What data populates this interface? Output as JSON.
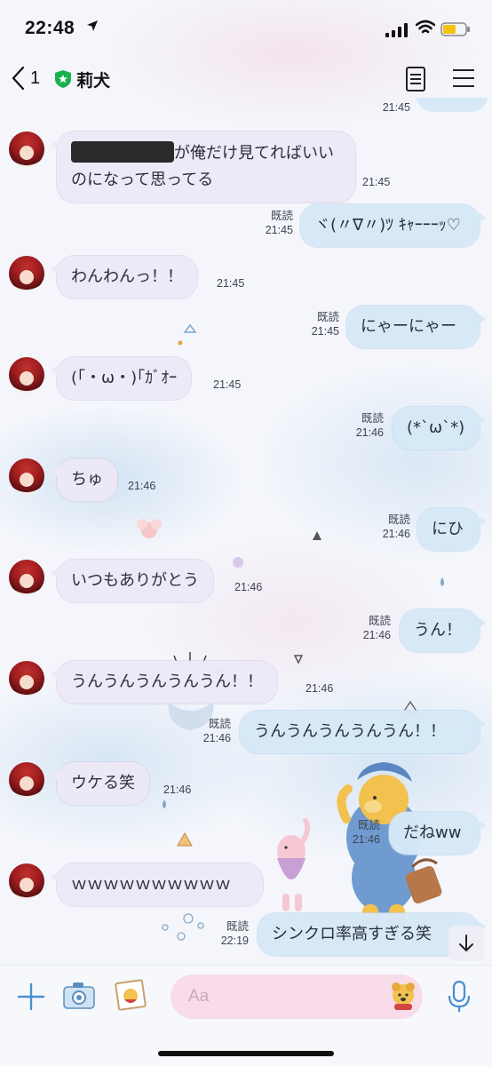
{
  "status_bar": {
    "time": "22:48"
  },
  "header": {
    "back_count": "1",
    "title": "莉犬"
  },
  "colors": {
    "bubble_incoming": "#ece8f6",
    "bubble_outgoing": "#d6e8f7",
    "input_background": "#f8dcea",
    "accent_icon": "#4a8fd1"
  },
  "messages": [
    {
      "side": "in",
      "text": "が俺だけ見てればいい\nのになって思ってる",
      "time": "21:45",
      "redacted_prefix": true
    },
    {
      "side": "out",
      "text": "ヾ(〃∇〃)ﾂ ｷｬｰｰｰｯ♡",
      "read": "既読",
      "time": "21:45"
    },
    {
      "side": "in",
      "text": "わんわんっ！！",
      "time": "21:45"
    },
    {
      "side": "out",
      "text": "にゃーにゃー",
      "read": "既読",
      "time": "21:45"
    },
    {
      "side": "in",
      "text": "(｢・ω・)｢ｶﾞｵｰ",
      "time": "21:45"
    },
    {
      "side": "out",
      "text": "(*`ω`*)",
      "read": "既読",
      "time": "21:46"
    },
    {
      "side": "in",
      "text": "ちゅ",
      "time": "21:46"
    },
    {
      "side": "out",
      "text": "にひ",
      "read": "既読",
      "time": "21:46"
    },
    {
      "side": "in",
      "text": "いつもありがとう",
      "time": "21:46"
    },
    {
      "side": "out",
      "text": "うん！",
      "read": "既読",
      "time": "21:46"
    },
    {
      "side": "in",
      "text": "うんうんうんうんうん！！",
      "time": "21:46"
    },
    {
      "side": "out",
      "text": "うんうんうんうんうん！！",
      "read": "既読",
      "time": "21:46"
    },
    {
      "side": "in",
      "text": "ウケる笑",
      "time": "21:46"
    },
    {
      "side": "out",
      "text": "だねww",
      "read": "既読",
      "time": "21:46"
    },
    {
      "side": "in",
      "text": "ｗｗｗｗｗｗｗｗｗｗ",
      "time": ""
    },
    {
      "side": "out",
      "text": "シンクロ率高すぎる笑",
      "read": "既読",
      "time": "22:19"
    }
  ],
  "partial_top_message": {
    "time": "21:45"
  },
  "input": {
    "placeholder": "Aa"
  },
  "icons": [
    "location-arrow-icon",
    "signal-icon",
    "wifi-icon",
    "battery-icon",
    "back-chevron-icon",
    "verified-badge-icon",
    "notes-icon",
    "menu-icon",
    "plus-icon",
    "camera-icon",
    "photo-icon",
    "sticker-icon",
    "mic-icon",
    "arrow-down-icon"
  ]
}
